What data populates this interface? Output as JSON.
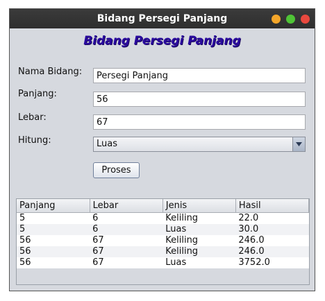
{
  "window": {
    "title": "Bidang Persegi Panjang"
  },
  "window_controls": {
    "minimize_color": "#f4a62a",
    "maximize_color": "#4fc436",
    "close_color": "#e8483e"
  },
  "form": {
    "heading": "Bidang Persegi Panjang",
    "nama_label": "Nama Bidang:",
    "nama_value": "Persegi Panjang",
    "panjang_label": "Panjang:",
    "panjang_value": "56",
    "lebar_label": "Lebar:",
    "lebar_value": "67",
    "hitung_label": "Hitung:",
    "hitung_selected": "Luas",
    "proses_label": "Proses"
  },
  "table": {
    "headers": [
      "Panjang",
      "Lebar",
      "Jenis",
      "Hasil"
    ],
    "rows": [
      [
        "5",
        "6",
        "Keliling",
        "22.0"
      ],
      [
        "5",
        "6",
        "Luas",
        "30.0"
      ],
      [
        "56",
        "67",
        "Keliling",
        "246.0"
      ],
      [
        "56",
        "67",
        "Keliling",
        "246.0"
      ],
      [
        "56",
        "67",
        "Luas",
        "3752.0"
      ]
    ]
  }
}
